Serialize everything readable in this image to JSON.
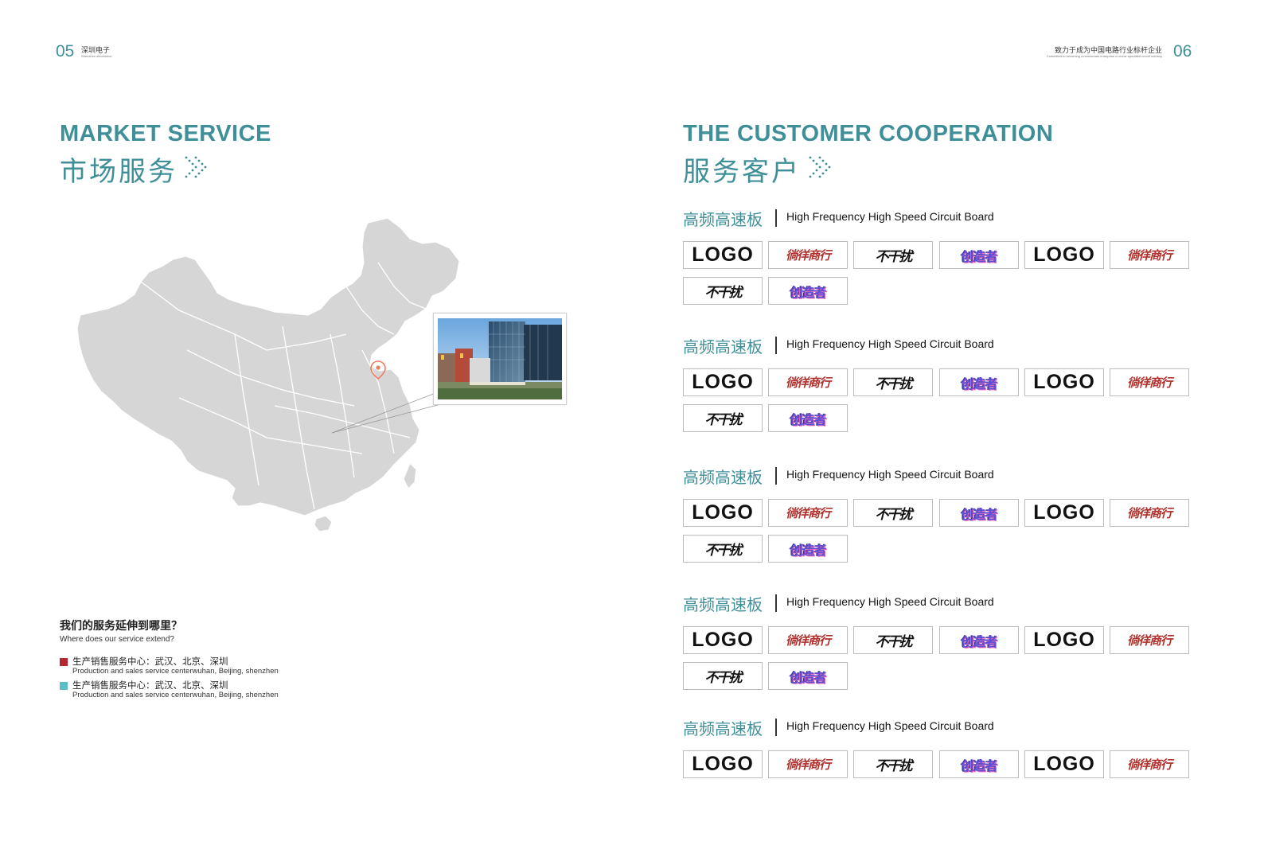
{
  "header": {
    "left_page_num": "05",
    "left_cn": "深圳电子",
    "left_en": "Shenzhen electronics",
    "right_page_num": "06",
    "right_cn": "致力于成为中国电路行业标杆企业",
    "right_en": "Committed to becoming a benchmark enterprise in china' specialist circuit industry"
  },
  "market": {
    "title_en": "MARKET SERVICE",
    "title_cn": "市场服务",
    "question_cn": "我们的服务延伸到哪里？",
    "question_en": "Where does our service extend?",
    "legend": [
      {
        "color": "#b7282e",
        "cn": "生产销售服务中心：武汉、北京、深圳",
        "en": "Production and sales service centerwuhan, Beijing, shenzhen"
      },
      {
        "color": "#5bbfc6",
        "cn": "生产销售服务中心：武汉、北京、深圳",
        "en": "Production and sales service centerwuhan, Beijing, shenzhen"
      }
    ]
  },
  "customers": {
    "title_en": "THE CUSTOMER COOPERATION",
    "title_cn": "服务客户",
    "sections": [
      {
        "cn": "高频高速板",
        "en": "High Frequency High Speed Circuit Board"
      },
      {
        "cn": "高频高速板",
        "en": "High Frequency High Speed Circuit Board"
      },
      {
        "cn": "高频高速板",
        "en": "High Frequency High Speed Circuit Board"
      },
      {
        "cn": "高频高速板",
        "en": "High Frequency High Speed Circuit Board"
      },
      {
        "cn": "高频高速板",
        "en": "High Frequency High Speed Circuit Board"
      }
    ],
    "logos": {
      "logo_word": "LOGO",
      "red_brand": "徜徉商行",
      "black_brand": "不干扰",
      "purple_brand": "创造者"
    }
  },
  "colors": {
    "accent": "#3f8f99",
    "map_fill": "#d6d6d6",
    "pin": "#ef7b5a"
  }
}
